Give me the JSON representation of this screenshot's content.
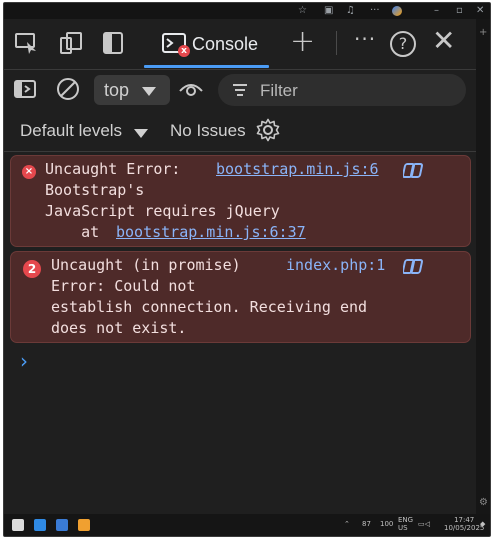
{
  "devtools": {
    "tabs": {
      "console_label": "Console",
      "error_badge": "x"
    },
    "toolbar": {
      "context_value": "top",
      "filter_placeholder": "Filter"
    },
    "levels": {
      "label": "Default levels",
      "issues": "No Issues"
    },
    "messages": [
      {
        "line1": "Uncaught Error:",
        "source": "bootstrap.min.js:6",
        "body": "Bootstrap's\nJavaScript requires jQuery",
        "at_prefix": "    at ",
        "at_link": "bootstrap.min.js:6:37"
      },
      {
        "count": "2",
        "line1": "Uncaught (in promise)",
        "source": "index.php:1",
        "body": "Error: Could not\nestablish connection. Receiving end\ndoes not exist."
      }
    ],
    "prompt": "›"
  },
  "taskbar": {
    "battery": "87",
    "wifi_label": "100",
    "lang_line1": "ENG",
    "lang_line2": "US",
    "time": "17:47",
    "date": "10/05/2025"
  },
  "colors": {
    "error_bg": "#4e2a29",
    "error_border": "#6b3a38",
    "accent": "#4b9cf5",
    "link": "#8ab4f8",
    "error_red": "#e5484d"
  }
}
